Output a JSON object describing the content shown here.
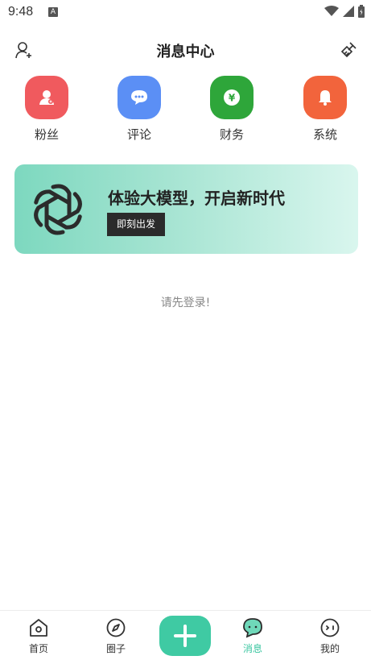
{
  "status_bar": {
    "time": "9:48",
    "badge": "A"
  },
  "header": {
    "title": "消息中心",
    "left_icon": "add-user-icon",
    "right_icon": "broom-icon"
  },
  "categories": [
    {
      "label": "粉丝",
      "icon": "fan-user-icon",
      "color": "#f05a5e"
    },
    {
      "label": "评论",
      "icon": "comment-icon",
      "color": "#5b8ff5"
    },
    {
      "label": "财务",
      "icon": "yen-icon",
      "color": "#2ea63a"
    },
    {
      "label": "系统",
      "icon": "bell-icon",
      "color": "#f2643c"
    }
  ],
  "banner": {
    "headline": "体验大模型，开启新时代",
    "button": "即刻出发",
    "logo": "openai-logo"
  },
  "login_hint": "请先登录!",
  "tabbar": {
    "items": [
      {
        "label": "首页",
        "icon": "home-icon"
      },
      {
        "label": "圈子",
        "icon": "compass-icon"
      },
      {
        "label": "消息",
        "icon": "chat-icon",
        "active": true
      },
      {
        "label": "我的",
        "icon": "profile-face-icon"
      }
    ],
    "plus_icon": "plus-icon",
    "active_color": "#3ac6a0"
  }
}
